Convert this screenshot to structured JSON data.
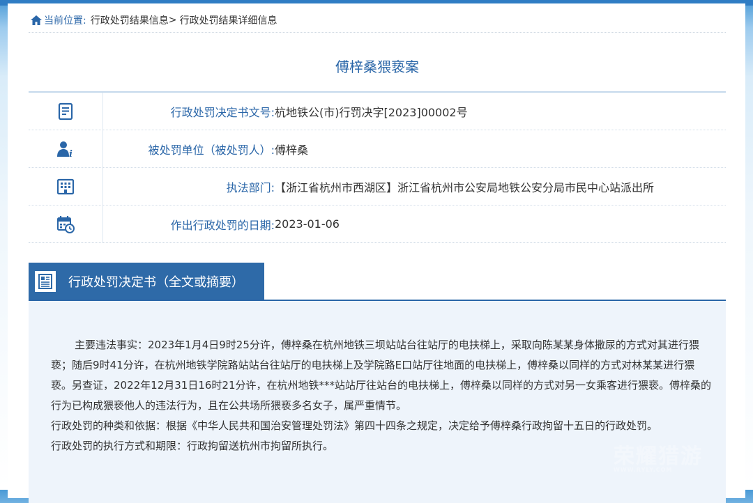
{
  "breadcrumb": {
    "lead": "当前位置:",
    "items": [
      "行政处罚结果信息",
      "行政处罚结果详细信息"
    ],
    "separator": ">"
  },
  "title": "傅梓桑猥亵案",
  "details": [
    {
      "icon": "document-icon",
      "label": "行政处罚决定书文号:",
      "value": "杭地铁公(市)行罚决字[2023]00002号"
    },
    {
      "icon": "person-info-icon",
      "label": "被处罚单位（被处罚人）:",
      "value": "傅梓桑"
    },
    {
      "icon": "building-icon",
      "label": "执法部门:",
      "value": "【浙江省杭州市西湖区】浙江省杭州市公安局地铁公安分局市民中心站派出所"
    },
    {
      "icon": "calendar-clock-icon",
      "label": "作出行政处罚的日期:",
      "value": "2023-01-06"
    }
  ],
  "section": {
    "icon": "decision-document-icon",
    "title": "行政处罚决定书（全文或摘要）"
  },
  "content": {
    "paragraph1": "主要违法事实：2023年1月4日9时25分许，傅梓桑在杭州地铁三坝站站台往站厅的电扶梯上，采取向陈某某身体撒尿的方式对其进行猥亵；随后9时41分许，在杭州地铁学院路站站台往站厅的电扶梯上及学院路E口站厅往地面的电扶梯上，傅梓桑以同样的方式对林某某进行猥亵。另查证，2022年12月31日16时21分许，在杭州地铁***站站厅往站台的电扶梯上，傅梓桑以同样的方式对另一女乘客进行猥亵。傅梓桑的行为已构成猥亵他人的违法行为，且在公共场所猥亵多名女子，属严重情节。",
    "paragraph2": "行政处罚的种类和依据：根据《中华人民共和国治安管理处罚法》第四十四条之规定，决定给予傅梓桑行政拘留十五日的行政处罚。",
    "paragraph3": "行政处罚的执行方式和期限：行政拘留送杭州市拘留所执行。"
  },
  "watermark": {
    "text": "荣耀猎游",
    "sub": "WWW.RYLY.COM"
  },
  "colors": {
    "accent": "#2a66a8",
    "content_bg": "#eef4fb",
    "section_tab": "#2e6aa8"
  }
}
